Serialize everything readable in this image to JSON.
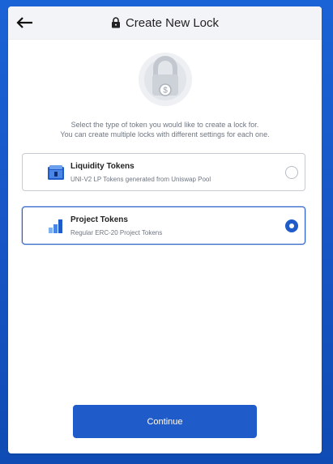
{
  "header": {
    "title": "Create New Lock"
  },
  "description": {
    "line1": "Select the type of token you would like to create a lock for.",
    "line2": "You can create multiple locks with different settings for each one."
  },
  "options": [
    {
      "title": "Liquidity Tokens",
      "subtitle": "UNI-V2 LP Tokens generated from Uniswap Pool",
      "selected": false,
      "icon": "liquidity-pool-icon"
    },
    {
      "title": "Project Tokens",
      "subtitle": "Regular ERC-20 Project Tokens",
      "selected": true,
      "icon": "bar-chart-icon"
    }
  ],
  "actions": {
    "continue_label": "Continue"
  },
  "colors": {
    "primary": "#1f5bc9",
    "background": "#1757c8"
  }
}
